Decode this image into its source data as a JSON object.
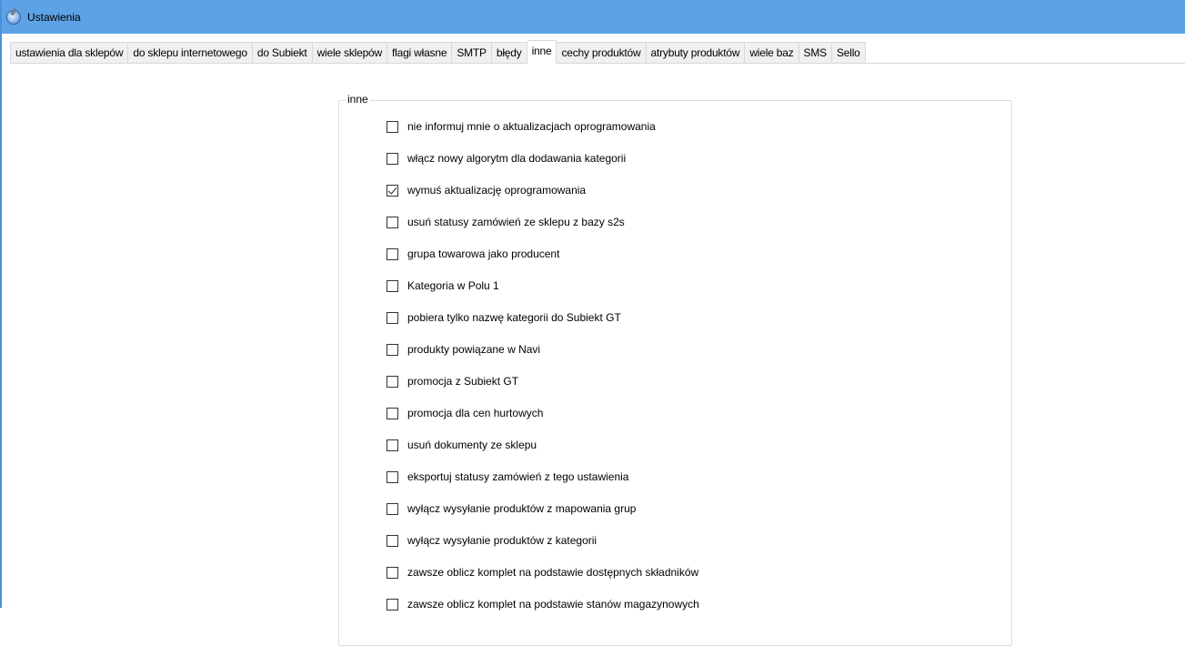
{
  "window": {
    "title": "Ustawienia",
    "icon": "settings-gear-globe-icon"
  },
  "tabs": [
    {
      "label": "ustawienia dla sklepów",
      "active": false
    },
    {
      "label": "do sklepu internetowego",
      "active": false
    },
    {
      "label": "do Subiekt",
      "active": false
    },
    {
      "label": "wiele sklepów",
      "active": false
    },
    {
      "label": "flagi własne",
      "active": false
    },
    {
      "label": "SMTP",
      "active": false
    },
    {
      "label": "błędy",
      "active": false
    },
    {
      "label": "inne",
      "active": true
    },
    {
      "label": "cechy produktów",
      "active": false
    },
    {
      "label": "atrybuty produktów",
      "active": false
    },
    {
      "label": "wiele baz",
      "active": false
    },
    {
      "label": "SMS",
      "active": false
    },
    {
      "label": "Sello",
      "active": false
    }
  ],
  "group": {
    "legend": "inne",
    "options": [
      {
        "label": "nie informuj mnie o aktualizacjach oprogramowania",
        "checked": false
      },
      {
        "label": "włącz nowy algorytm dla dodawania kategorii",
        "checked": false
      },
      {
        "label": "wymuś aktualizację oprogramowania",
        "checked": true
      },
      {
        "label": "usuń statusy zamówień ze sklepu z bazy s2s",
        "checked": false
      },
      {
        "label": "grupa towarowa jako producent",
        "checked": false
      },
      {
        "label": "Kategoria w Polu 1",
        "checked": false
      },
      {
        "label": "pobiera tylko nazwę kategorii do Subiekt GT",
        "checked": false
      },
      {
        "label": "produkty powiązane w Navi",
        "checked": false
      },
      {
        "label": "promocja z Subiekt GT",
        "checked": false
      },
      {
        "label": "promocja dla cen hurtowych",
        "checked": false
      },
      {
        "label": "usuń dokumenty ze sklepu",
        "checked": false
      },
      {
        "label": "eksportuj statusy zamówień z tego ustawienia",
        "checked": false
      },
      {
        "label": "wyłącz wysyłanie produktów z mapowania grup",
        "checked": false
      },
      {
        "label": "wyłącz wysyłanie produktów z kategorii",
        "checked": false
      },
      {
        "label": "zawsze oblicz komplet na podstawie dostępnych składników",
        "checked": false
      },
      {
        "label": "zawsze oblicz komplet na podstawie stanów magazynowych",
        "checked": false
      }
    ]
  }
}
